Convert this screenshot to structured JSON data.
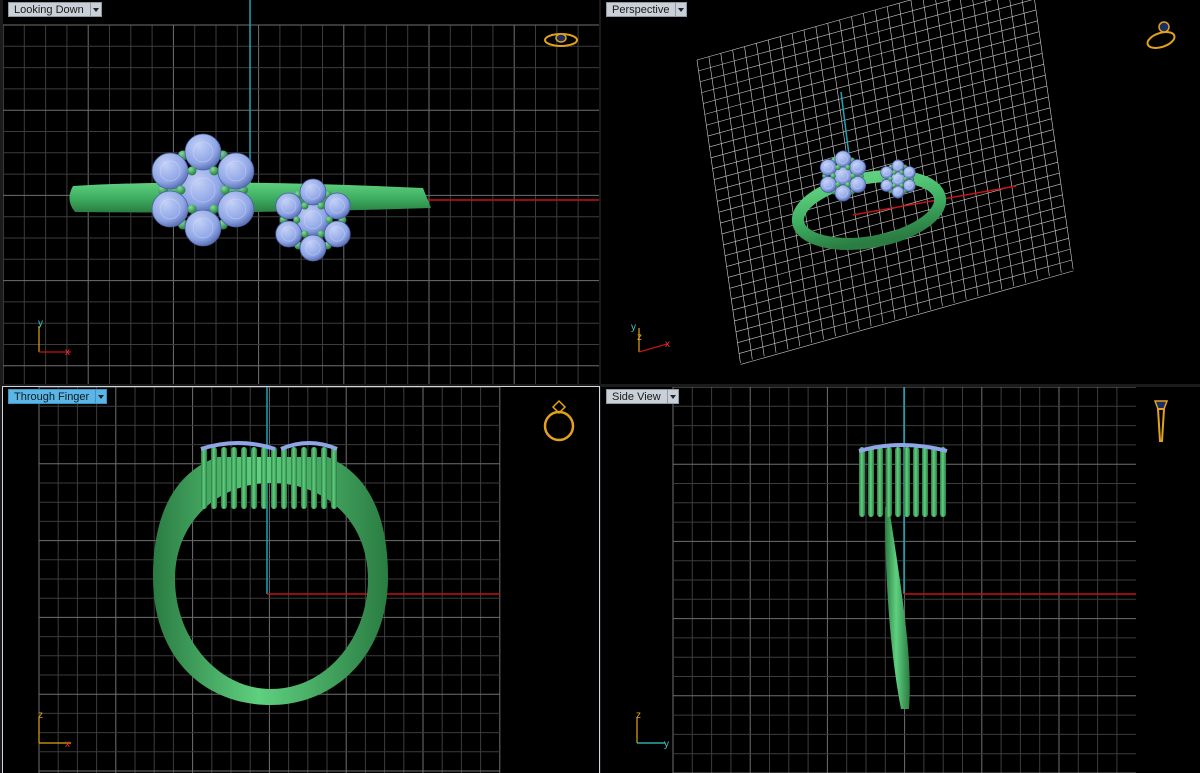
{
  "viewports": {
    "top_left": {
      "title": "Looking Down",
      "axis_a": "y",
      "axis_b": "x",
      "icon": "ring-top-view-icon"
    },
    "top_right": {
      "title": "Perspective",
      "axis_a": "y",
      "axis_b": "x",
      "axis_c": "z",
      "icon": "ring-perspective-icon"
    },
    "bottom_left": {
      "title": "Through Finger",
      "axis_a": "z",
      "axis_b": "x",
      "icon": "ring-front-view-icon"
    },
    "bottom_right": {
      "title": "Side View",
      "axis_a": "z",
      "axis_b": "y",
      "icon": "ring-side-view-icon"
    }
  },
  "active_viewport": "Through Finger",
  "colors": {
    "grid": "#6f6f6f",
    "grid_minor": "#3c3c3c",
    "x_axis": "#c41414",
    "z_axis": "#1aa6b6",
    "metal": "#3fb062",
    "metal_dark": "#2a7c42",
    "gem": "#8fa6e6",
    "gem_light": "#c3d0f7",
    "icon": "#e2a31a"
  }
}
